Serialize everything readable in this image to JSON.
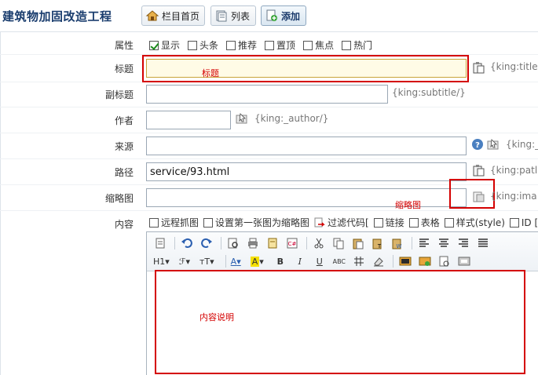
{
  "header": {
    "title": "建筑物加固改造工程",
    "buttons": [
      {
        "label": "栏目首页",
        "icon": "home-icon"
      },
      {
        "label": "列表",
        "icon": "list-icon"
      },
      {
        "label": "添加",
        "icon": "add-page-icon"
      }
    ]
  },
  "form": {
    "attributes": {
      "label": "属性",
      "options": [
        {
          "label": "显示",
          "checked": true
        },
        {
          "label": "头条",
          "checked": false
        },
        {
          "label": "推荐",
          "checked": false
        },
        {
          "label": "置顶",
          "checked": false
        },
        {
          "label": "焦点",
          "checked": false
        },
        {
          "label": "热门",
          "checked": false
        }
      ]
    },
    "title": {
      "label": "标题",
      "value": "",
      "annotation": "标题",
      "tag": "{king:title"
    },
    "subtitle": {
      "label": "副标题",
      "value": "",
      "tag": "{king:subtitle/}"
    },
    "author": {
      "label": "作者",
      "value": "",
      "tag": "{king:_author/}"
    },
    "source": {
      "label": "来源",
      "value": "",
      "tag": "{king:_"
    },
    "path": {
      "label": "路径",
      "value": "service/93.html",
      "tag": "{king:patl"
    },
    "thumbnail": {
      "label": "缩略图",
      "value": "",
      "annotation": "缩略图",
      "tag": "{king:ima"
    },
    "content": {
      "label": "内容",
      "options": [
        {
          "label": "远程抓图"
        },
        {
          "label": "设置第一张图为缩略图"
        },
        {
          "label": "过滤代码["
        },
        {
          "label": "链接"
        },
        {
          "label": "表格"
        },
        {
          "label": "样式(style)"
        },
        {
          "label": "ID ["
        }
      ],
      "toolbar_row2": {
        "heading": "H1",
        "font": "ℱ",
        "size": "тT",
        "font_color": "A",
        "bg_color": "A",
        "bold": "B",
        "italic": "I",
        "underline": "U",
        "strike": "ABC"
      },
      "annotation": "内容说明"
    }
  },
  "colors": {
    "annotation_red": "#d40000",
    "title_blue": "#1a3d6e"
  }
}
